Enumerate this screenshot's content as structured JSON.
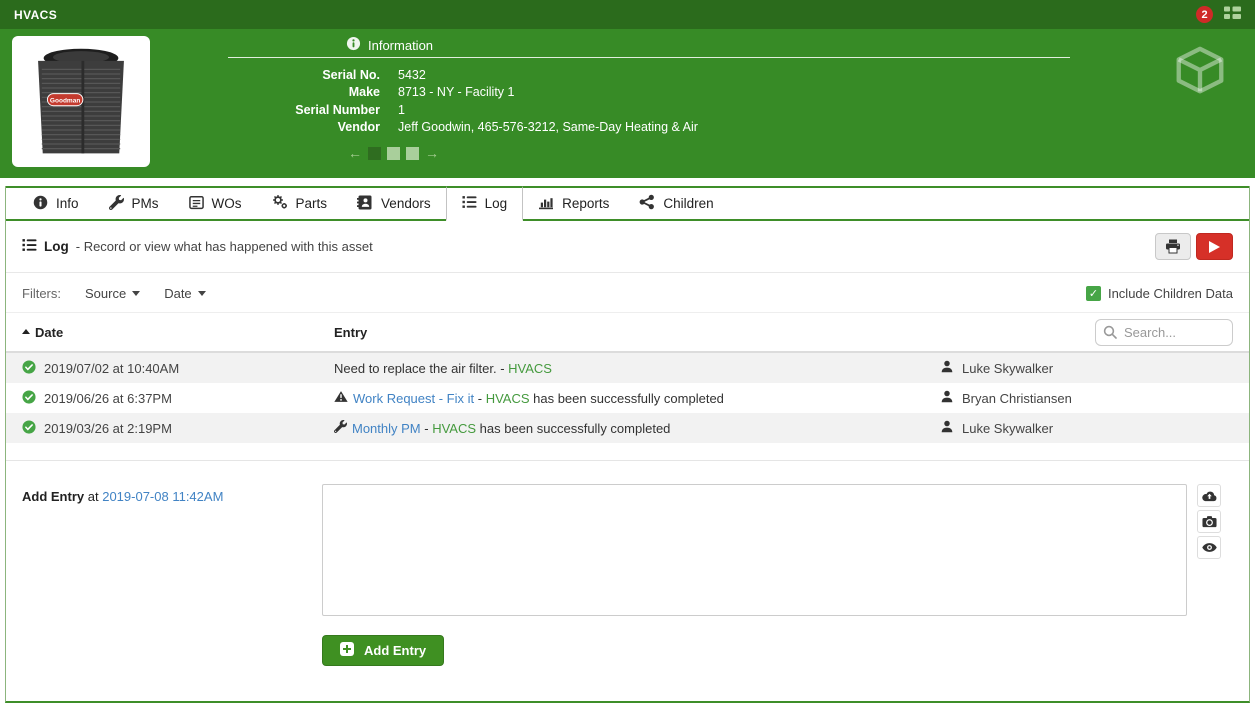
{
  "header": {
    "title": "HVACS",
    "notification_count": "2",
    "asset_brand": "Goodman",
    "info_section": {
      "title": "Information",
      "fields": [
        {
          "label": "Serial No.",
          "value": "5432"
        },
        {
          "label": "Make",
          "value": "8713 - NY - Facility 1"
        },
        {
          "label": "Serial Number",
          "value": "1"
        },
        {
          "label": "Vendor",
          "value": "Jeff Goodwin, 465-576-3212, Same-Day Heating & Air"
        }
      ]
    },
    "carousel": {
      "prev": "←",
      "next": "→",
      "pages": 3,
      "active_page": 1
    }
  },
  "tabs": [
    {
      "label": "Info",
      "icon": "info-circle-icon",
      "active": false
    },
    {
      "label": "PMs",
      "icon": "wrench-icon",
      "active": false
    },
    {
      "label": "WOs",
      "icon": "work-order-icon",
      "active": false
    },
    {
      "label": "Parts",
      "icon": "cogs-icon",
      "active": false
    },
    {
      "label": "Vendors",
      "icon": "address-book-icon",
      "active": false
    },
    {
      "label": "Log",
      "icon": "list-icon",
      "active": true
    },
    {
      "label": "Reports",
      "icon": "bar-chart-icon",
      "active": false
    },
    {
      "label": "Children",
      "icon": "share-nodes-icon",
      "active": false
    }
  ],
  "log_panel": {
    "title": "Log",
    "subtitle": "- Record or view what has happened with this asset"
  },
  "filters": {
    "label": "Filters:",
    "source": "Source",
    "date": "Date",
    "include_children": "Include Children Data",
    "include_children_checked": true
  },
  "log_table": {
    "columns": {
      "date": "Date",
      "entry": "Entry"
    },
    "search_placeholder": "Search...",
    "rows": [
      {
        "status_icon": "check-circle-icon",
        "date": "2019/07/02 at 10:40AM",
        "entry_text": "Need to replace the air filter. - ",
        "asset_link": "HVACS",
        "entry_suffix": "",
        "user": "Luke Skywalker"
      },
      {
        "status_icon": "check-circle-icon",
        "date": "2019/06/26 at 6:37PM",
        "entry_icon": "warning-icon",
        "entry_link": "Work Request - Fix it",
        "separator": " - ",
        "asset_link": "HVACS",
        "entry_suffix": " has been successfully completed",
        "user": "Bryan Christiansen"
      },
      {
        "status_icon": "check-circle-icon",
        "date": "2019/03/26 at 2:19PM",
        "entry_icon": "wrench-icon",
        "entry_link": "Monthly PM",
        "separator": " - ",
        "asset_link": "HVACS",
        "entry_suffix": " has been successfully completed",
        "user": "Luke Skywalker"
      }
    ]
  },
  "add_entry": {
    "label": "Add Entry",
    "at": "at",
    "timestamp": "2019-07-08 11:42AM",
    "button": "Add Entry"
  },
  "icons": {
    "search": "magnifier",
    "print": "printer",
    "video": "play-triangle",
    "upload": "cloud-upload",
    "photo": "camera",
    "preview": "eye",
    "sort": "caret-up",
    "status": "check-circle",
    "user": "person",
    "work_request": "triangle-exclamation",
    "pm": "wrench",
    "cube": "3d-box",
    "grid": "table-list"
  },
  "colors": {
    "topbar_green": "#2b6b1c",
    "header_green": "#378b26",
    "accent_green": "#3e8e29",
    "link_green": "#459a3e",
    "link_blue": "#4183c4",
    "badge_red": "#cf2a27",
    "play_red": "#d63028",
    "check_green": "#46a546",
    "row_alt": "#f2f2f2"
  }
}
